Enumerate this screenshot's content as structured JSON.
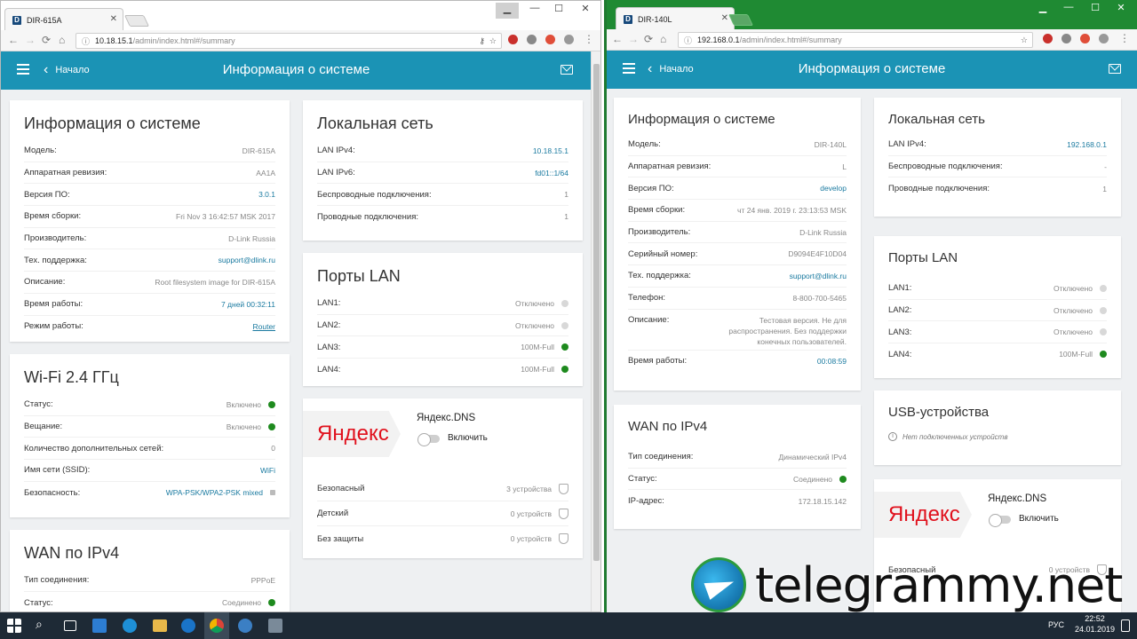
{
  "left": {
    "tab_title": "DIR-615A",
    "url_host": "10.18.15.1",
    "url_path": "/admin/index.html#/summary",
    "back_label": "Начало",
    "title": "Информация о системе",
    "sysinfo": {
      "heading": "Информация о системе",
      "rows": [
        {
          "k": "Модель:",
          "v": "DIR-615A"
        },
        {
          "k": "Аппаратная ревизия:",
          "v": "AA1A"
        },
        {
          "k": "Версия ПО:",
          "v": "3.0.1"
        },
        {
          "k": "Время сборки:",
          "v": "Fri Nov 3 16:42:57 MSK 2017"
        },
        {
          "k": "Производитель:",
          "v": "D-Link Russia"
        },
        {
          "k": "Тех. поддержка:",
          "v": "support@dlink.ru"
        },
        {
          "k": "Описание:",
          "v": "Root filesystem image for DIR-615A"
        },
        {
          "k": "Время работы:",
          "v": "7 дней 00:32:11"
        },
        {
          "k": "Режим работы:",
          "v": "Router"
        }
      ]
    },
    "wifi": {
      "heading": "Wi-Fi 2.4 ГГц",
      "rows": [
        {
          "k": "Статус:",
          "v": "Включено"
        },
        {
          "k": "Вещание:",
          "v": "Включено"
        },
        {
          "k": "Количество дополнительных сетей:",
          "v": "0"
        },
        {
          "k": "Имя сети (SSID):",
          "v": "WiFi"
        },
        {
          "k": "Безопасность:",
          "v": "WPA-PSK/WPA2-PSK mixed"
        }
      ]
    },
    "wan": {
      "heading": "WAN по IPv4",
      "rows": [
        {
          "k": "Тип соединения:",
          "v": "PPPoE"
        },
        {
          "k": "Статус:",
          "v": "Соединено"
        }
      ]
    },
    "lan": {
      "heading": "Локальная сеть",
      "rows": [
        {
          "k": "LAN IPv4:",
          "v": "10.18.15.1"
        },
        {
          "k": "LAN IPv6:",
          "v": "fd01::1/64"
        },
        {
          "k": "Беспроводные подключения:",
          "v": "1"
        },
        {
          "k": "Проводные подключения:",
          "v": "1"
        }
      ]
    },
    "ports": {
      "heading": "Порты LAN",
      "rows": [
        {
          "k": "LAN1:",
          "v": "Отключено"
        },
        {
          "k": "LAN2:",
          "v": "Отключено"
        },
        {
          "k": "LAN3:",
          "v": "100M-Full"
        },
        {
          "k": "LAN4:",
          "v": "100M-Full"
        }
      ]
    },
    "yandex": {
      "logo": "Яндекс",
      "title": "Яндекс.DNS",
      "toggle_label": "Включить",
      "rows": [
        {
          "k": "Безопасный",
          "v": "3 устройства"
        },
        {
          "k": "Детский",
          "v": "0 устройств"
        },
        {
          "k": "Без защиты",
          "v": "0 устройств"
        }
      ]
    }
  },
  "right": {
    "tab_title": "DIR-140L",
    "url_host": "192.168.0.1",
    "url_path": "/admin/index.html#/summary",
    "back_label": "Начало",
    "title": "Информация о системе",
    "sysinfo": {
      "heading": "Информация о системе",
      "rows": [
        {
          "k": "Модель:",
          "v": "DIR-140L"
        },
        {
          "k": "Аппаратная ревизия:",
          "v": "L"
        },
        {
          "k": "Версия ПО:",
          "v": "develop"
        },
        {
          "k": "Время сборки:",
          "v": "чт 24 янв. 2019 г. 23:13:53 MSK"
        },
        {
          "k": "Производитель:",
          "v": "D-Link Russia"
        },
        {
          "k": "Серийный номер:",
          "v": "D9094E4F10D04"
        },
        {
          "k": "Тех. поддержка:",
          "v": "support@dlink.ru"
        },
        {
          "k": "Телефон:",
          "v": "8-800-700-5465"
        }
      ],
      "desc_key": "Описание:",
      "desc_value": "Тестовая версия. Не для распространения. Без поддержки конечных пользователей.",
      "uptime_key": "Время работы:",
      "uptime_value": "00:08:59"
    },
    "wan": {
      "heading": "WAN по IPv4",
      "rows": [
        {
          "k": "Тип соединения:",
          "v": "Динамический IPv4"
        },
        {
          "k": "Статус:",
          "v": "Соединено"
        },
        {
          "k": "IP-адрес:",
          "v": "172.18.15.142"
        }
      ]
    },
    "lan": {
      "heading": "Локальная сеть",
      "rows": [
        {
          "k": "LAN IPv4:",
          "v": "192.168.0.1"
        },
        {
          "k": "Беспроводные подключения:",
          "v": "-"
        },
        {
          "k": "Проводные подключения:",
          "v": "1"
        }
      ]
    },
    "ports": {
      "heading": "Порты LAN",
      "rows": [
        {
          "k": "LAN1:",
          "v": "Отключено"
        },
        {
          "k": "LAN2:",
          "v": "Отключено"
        },
        {
          "k": "LAN3:",
          "v": "Отключено"
        },
        {
          "k": "LAN4:",
          "v": "100M-Full"
        }
      ]
    },
    "usb": {
      "heading": "USB-устройства",
      "info": "Нет подключенных устройств"
    },
    "yandex": {
      "logo": "Яндекс",
      "title": "Яндекс.DNS",
      "toggle_label": "Включить",
      "row1_k": "Безопасный",
      "row1_v": "0 устройств"
    }
  },
  "watermark": "telegrammy.net",
  "taskbar": {
    "lang": "РУС",
    "time": "22:52",
    "date": "24.01.2019"
  },
  "colors": {
    "appbar": "#1b93b5",
    "accent_green": "#1e8a1e",
    "link": "#1a7aa0"
  }
}
